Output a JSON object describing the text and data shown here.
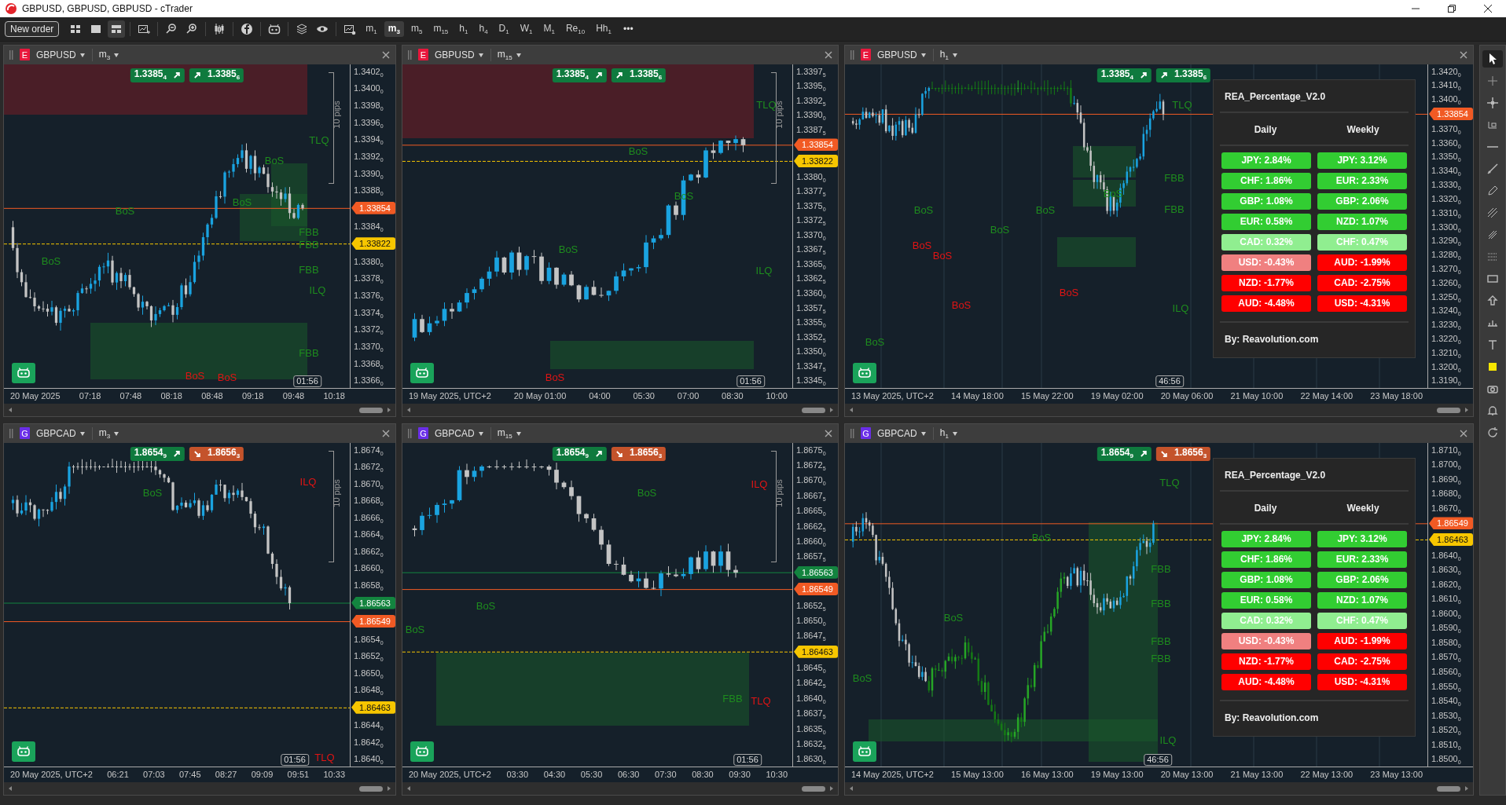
{
  "window": {
    "title": "GBPUSD, GBPUSD, GBPUSD - cTrader"
  },
  "toolbar": {
    "new_order": "New order",
    "more": "•••",
    "timeframes": [
      {
        "label": "m$_{1}$",
        "selected": false
      },
      {
        "label": "m$_{3}$",
        "selected": true
      },
      {
        "label": "m$_{5}$",
        "selected": false
      },
      {
        "label": "m$_{15}$",
        "selected": false
      },
      {
        "label": "h$_{1}$",
        "selected": false
      },
      {
        "label": "h$_{4}$",
        "selected": false
      },
      {
        "label": "D$_{1}$",
        "selected": false
      },
      {
        "label": "W$_{1}$",
        "selected": false
      },
      {
        "label": "M$_{1}$",
        "selected": false
      },
      {
        "label": "Re$_{10}$",
        "selected": false
      },
      {
        "label": "Hh$_{1}$",
        "selected": false
      }
    ]
  },
  "charts": [
    {
      "badge": {
        "letter": "E",
        "color": "#e8173c"
      },
      "symbol": "GBPUSD",
      "timeframe": "m$_{3}$",
      "pips": "10 pips",
      "timer": "01:56",
      "prices": [
        {
          "text": "1.3385$_{4}$",
          "kind": "up"
        },
        {
          "text": "1.3385$_{6}$",
          "kind": "up"
        }
      ],
      "y_axis": [
        {
          "kind": "tick",
          "text": "1.3402$_{0}$"
        },
        {
          "kind": "tick",
          "text": "1.3400$_{0}$"
        },
        {
          "kind": "tick",
          "text": "1.3398$_{0}$"
        },
        {
          "kind": "tick",
          "text": "1.3396$_{0}$"
        },
        {
          "kind": "tick",
          "text": "1.3394$_{0}$"
        },
        {
          "kind": "tick",
          "text": "1.3392$_{0}$"
        },
        {
          "kind": "tick",
          "text": "1.3390$_{0}$"
        },
        {
          "kind": "tick",
          "text": "1.3388$_{0}$"
        },
        {
          "kind": "tag",
          "text": "1.33854",
          "color": "#f15a24"
        },
        {
          "kind": "tick",
          "text": "1.3384$_{0}$"
        },
        {
          "kind": "tag",
          "text": "1.33822",
          "color": "#f7c600"
        },
        {
          "kind": "tick",
          "text": "1.3380$_{0}$"
        },
        {
          "kind": "tick",
          "text": "1.3378$_{0}$"
        },
        {
          "kind": "tick",
          "text": "1.3376$_{0}$"
        },
        {
          "kind": "tick",
          "text": "1.3374$_{0}$"
        },
        {
          "kind": "tick",
          "text": "1.3372$_{0}$"
        },
        {
          "kind": "tick",
          "text": "1.3370$_{0}$"
        },
        {
          "kind": "tick",
          "text": "1.3368$_{0}$"
        },
        {
          "kind": "tick",
          "text": "1.3366$_{0}$"
        }
      ],
      "x_axis": [
        "20 May 2025",
        "07:18",
        "07:48",
        "08:18",
        "08:48",
        "09:18",
        "09:48",
        "10:18"
      ],
      "annotations": [
        {
          "text": "TLQ",
          "color": "#1e8c1e"
        },
        {
          "text": "BoS",
          "color": "#1e8c1e"
        },
        {
          "text": "BoS",
          "color": "#1e8c1e"
        },
        {
          "text": "BoS",
          "color": "#1e8c1e"
        },
        {
          "text": "FBB",
          "color": "#1e8c1e"
        },
        {
          "text": "FBB",
          "color": "#1e8c1e"
        },
        {
          "text": "FBB",
          "color": "#1e8c1e"
        },
        {
          "text": "ILQ",
          "color": "#1e8c1e"
        },
        {
          "text": "BoS",
          "color": "#1e8c1e"
        },
        {
          "text": "FBB",
          "color": "#1e8c1e"
        },
        {
          "text": "BoS",
          "color": "#e01414"
        },
        {
          "text": "BoS",
          "color": "#e01414"
        }
      ]
    },
    {
      "badge": {
        "letter": "E",
        "color": "#e8173c"
      },
      "symbol": "GBPUSD",
      "timeframe": "m$_{15}$",
      "pips": "10 pips",
      "timer": "01:56",
      "prices": [
        {
          "text": "1.3385$_{4}$",
          "kind": "up"
        },
        {
          "text": "1.3385$_{6}$",
          "kind": "up"
        }
      ],
      "y_axis": [
        {
          "kind": "tick",
          "text": "1.3397$_{5}$"
        },
        {
          "kind": "tick",
          "text": "1.3395$_{0}$"
        },
        {
          "kind": "tick",
          "text": "1.3392$_{5}$"
        },
        {
          "kind": "tick",
          "text": "1.3390$_{0}$"
        },
        {
          "kind": "tick",
          "text": "1.3387$_{5}$"
        },
        {
          "kind": "tag",
          "text": "1.33854",
          "color": "#f15a24"
        },
        {
          "kind": "tag",
          "text": "1.33822",
          "color": "#f7c600"
        },
        {
          "kind": "tick",
          "text": "1.3380$_{0}$"
        },
        {
          "kind": "tick",
          "text": "1.3377$_{5}$"
        },
        {
          "kind": "tick",
          "text": "1.3375$_{0}$"
        },
        {
          "kind": "tick",
          "text": "1.3372$_{5}$"
        },
        {
          "kind": "tick",
          "text": "1.3370$_{0}$"
        },
        {
          "kind": "tick",
          "text": "1.3367$_{5}$"
        },
        {
          "kind": "tick",
          "text": "1.3365$_{0}$"
        },
        {
          "kind": "tick",
          "text": "1.3362$_{5}$"
        },
        {
          "kind": "tick",
          "text": "1.3360$_{0}$"
        },
        {
          "kind": "tick",
          "text": "1.3357$_{5}$"
        },
        {
          "kind": "tick",
          "text": "1.3355$_{0}$"
        },
        {
          "kind": "tick",
          "text": "1.3352$_{5}$"
        },
        {
          "kind": "tick",
          "text": "1.3350$_{0}$"
        },
        {
          "kind": "tick",
          "text": "1.3347$_{5}$"
        },
        {
          "kind": "tick",
          "text": "1.3345$_{0}$"
        }
      ],
      "x_axis": [
        "19 May 2025, UTC+2",
        "20 May 01:00",
        "04:00",
        "05:30",
        "07:00",
        "08:30",
        "10:00"
      ],
      "annotations": [
        {
          "text": "TLQ",
          "color": "#1e8c1e"
        },
        {
          "text": "BoS",
          "color": "#1e8c1e"
        },
        {
          "text": "BoS",
          "color": "#1e8c1e"
        },
        {
          "text": "BoS",
          "color": "#1e8c1e"
        },
        {
          "text": "ILQ",
          "color": "#1e8c1e"
        },
        {
          "text": "BoS",
          "color": "#e01414"
        }
      ]
    },
    {
      "badge": {
        "letter": "E",
        "color": "#e8173c"
      },
      "symbol": "GBPUSD",
      "timeframe": "h$_{1}$",
      "timer": "46:56",
      "prices": [
        {
          "text": "1.3385$_{4}$",
          "kind": "up"
        },
        {
          "text": "1.3385$_{6}$",
          "kind": "up"
        }
      ],
      "y_axis": [
        {
          "kind": "tick",
          "text": "1.3420$_{0}$"
        },
        {
          "kind": "tick",
          "text": "1.3410$_{0}$"
        },
        {
          "kind": "tick",
          "text": "1.3400$_{0}$"
        },
        {
          "kind": "tag",
          "text": "1.33854",
          "color": "#f15a24"
        },
        {
          "kind": "tick",
          "text": "1.3370$_{0}$"
        },
        {
          "kind": "tick",
          "text": "1.3360$_{0}$"
        },
        {
          "kind": "tick",
          "text": "1.3350$_{0}$"
        },
        {
          "kind": "tick",
          "text": "1.3340$_{0}$"
        },
        {
          "kind": "tick",
          "text": "1.3330$_{0}$"
        },
        {
          "kind": "tick",
          "text": "1.3320$_{0}$"
        },
        {
          "kind": "tick",
          "text": "1.3310$_{0}$"
        },
        {
          "kind": "tick",
          "text": "1.3300$_{0}$"
        },
        {
          "kind": "tick",
          "text": "1.3290$_{0}$"
        },
        {
          "kind": "tick",
          "text": "1.3280$_{0}$"
        },
        {
          "kind": "tick",
          "text": "1.3270$_{0}$"
        },
        {
          "kind": "tick",
          "text": "1.3260$_{0}$"
        },
        {
          "kind": "tick",
          "text": "1.3250$_{0}$"
        },
        {
          "kind": "tick",
          "text": "1.3240$_{0}$"
        },
        {
          "kind": "tick",
          "text": "1.3230$_{0}$"
        },
        {
          "kind": "tick",
          "text": "1.3220$_{0}$"
        },
        {
          "kind": "tick",
          "text": "1.3210$_{0}$"
        },
        {
          "kind": "tick",
          "text": "1.3200$_{0}$"
        },
        {
          "kind": "tick",
          "text": "1.3190$_{0}$"
        }
      ],
      "x_axis": [
        "13 May 2025, UTC+2",
        "14 May 18:00",
        "15 May 22:00",
        "19 May 02:00",
        "20 May 06:00",
        "21 May 10:00",
        "22 May 14:00",
        "23 May 18:00"
      ],
      "annotations": [
        {
          "text": "TLQ",
          "color": "#1e8c1e"
        },
        {
          "text": "FBB",
          "color": "#1e8c1e"
        },
        {
          "text": "FBB",
          "color": "#1e8c1e"
        },
        {
          "text": "ILQ",
          "color": "#1e8c1e"
        },
        {
          "text": "BoS",
          "color": "#e01414"
        },
        {
          "text": "BoS",
          "color": "#e01414"
        },
        {
          "text": "BoS",
          "color": "#e01414"
        },
        {
          "text": "BoS",
          "color": "#e01414"
        },
        {
          "text": "BoS",
          "color": "#1e8c1e"
        },
        {
          "text": "BoS",
          "color": "#1e8c1e"
        },
        {
          "text": "BoS",
          "color": "#1e8c1e"
        },
        {
          "text": "BoS",
          "color": "#1e8c1e"
        },
        {
          "text": "BoS",
          "color": "#1e8c1e"
        }
      ],
      "indicator_panel": {
        "title": "REA_Percentage_V2.0",
        "columns": [
          "Daily",
          "Weekly"
        ],
        "rows": [
          {
            "cells": [
              {
                "text": "JPY: 2.84%",
                "color": "#32cd32"
              },
              {
                "text": "JPY: 3.12%",
                "color": "#32cd32"
              }
            ]
          },
          {
            "cells": [
              {
                "text": "CHF: 1.86%",
                "color": "#32cd32"
              },
              {
                "text": "EUR: 2.33%",
                "color": "#32cd32"
              }
            ]
          },
          {
            "cells": [
              {
                "text": "GBP: 1.08%",
                "color": "#32cd32"
              },
              {
                "text": "GBP: 2.06%",
                "color": "#32cd32"
              }
            ]
          },
          {
            "cells": [
              {
                "text": "EUR: 0.58%",
                "color": "#32cd32"
              },
              {
                "text": "NZD: 1.07%",
                "color": "#32cd32"
              }
            ]
          },
          {
            "cells": [
              {
                "text": "CAD: 0.32%",
                "color": "#90ee90"
              },
              {
                "text": "CHF: 0.47%",
                "color": "#90ee90"
              }
            ]
          },
          {
            "cells": [
              {
                "text": "USD: -0.43%",
                "color": "#f08080"
              },
              {
                "text": "AUD: -1.99%",
                "color": "#ff0000"
              }
            ]
          },
          {
            "cells": [
              {
                "text": "NZD: -1.77%",
                "color": "#ff0000"
              },
              {
                "text": "CAD: -2.75%",
                "color": "#ff0000"
              }
            ]
          },
          {
            "cells": [
              {
                "text": "AUD: -4.48%",
                "color": "#ff0000"
              },
              {
                "text": "USD: -4.31%",
                "color": "#ff0000"
              }
            ]
          }
        ],
        "footer": "By: Reavolution.com"
      }
    },
    {
      "badge": {
        "letter": "G",
        "color": "#6a2ee8"
      },
      "symbol": "GBPCAD",
      "timeframe": "m$_{3}$",
      "pips": "10 pips",
      "timer": "01:56",
      "prices": [
        {
          "text": "1.8654$_{9}$",
          "kind": "up"
        },
        {
          "text": "1.8656$_{3}$",
          "kind": "down"
        }
      ],
      "y_axis": [
        {
          "kind": "tick",
          "text": "1.8674$_{0}$"
        },
        {
          "kind": "tick",
          "text": "1.8672$_{0}$"
        },
        {
          "kind": "tick",
          "text": "1.8670$_{0}$"
        },
        {
          "kind": "tick",
          "text": "1.8668$_{0}$"
        },
        {
          "kind": "tick",
          "text": "1.8666$_{0}$"
        },
        {
          "kind": "tick",
          "text": "1.8664$_{0}$"
        },
        {
          "kind": "tick",
          "text": "1.8662$_{0}$"
        },
        {
          "kind": "tick",
          "text": "1.8660$_{0}$"
        },
        {
          "kind": "tick",
          "text": "1.8658$_{0}$"
        },
        {
          "kind": "tag",
          "text": "1.86563",
          "color": "#13843f"
        },
        {
          "kind": "tag",
          "text": "1.86549",
          "color": "#f15a24"
        },
        {
          "kind": "tick",
          "text": "1.8654$_{0}$"
        },
        {
          "kind": "tick",
          "text": "1.8652$_{0}$"
        },
        {
          "kind": "tick",
          "text": "1.8650$_{0}$"
        },
        {
          "kind": "tick",
          "text": "1.8648$_{0}$"
        },
        {
          "kind": "tag",
          "text": "1.86463",
          "color": "#f7c600"
        },
        {
          "kind": "tick",
          "text": "1.8644$_{0}$"
        },
        {
          "kind": "tick",
          "text": "1.8642$_{0}$"
        },
        {
          "kind": "tick",
          "text": "1.8640$_{0}$"
        }
      ],
      "x_axis": [
        "20 May 2025, UTC+2",
        "06:21",
        "07:03",
        "07:45",
        "08:27",
        "09:09",
        "09:51",
        "10:33"
      ],
      "annotations": [
        {
          "text": "ILQ",
          "color": "#e01414"
        },
        {
          "text": "BoS",
          "color": "#1e8c1e"
        },
        {
          "text": "TLQ",
          "color": "#e01414"
        }
      ]
    },
    {
      "badge": {
        "letter": "G",
        "color": "#6a2ee8"
      },
      "symbol": "GBPCAD",
      "timeframe": "m$_{15}$",
      "pips": "10 pips",
      "timer": "01:56",
      "prices": [
        {
          "text": "1.8654$_{9}$",
          "kind": "up"
        },
        {
          "text": "1.8656$_{3}$",
          "kind": "down"
        }
      ],
      "y_axis": [
        {
          "kind": "tick",
          "text": "1.8675$_{0}$"
        },
        {
          "kind": "tick",
          "text": "1.8672$_{5}$"
        },
        {
          "kind": "tick",
          "text": "1.8670$_{0}$"
        },
        {
          "kind": "tick",
          "text": "1.8667$_{5}$"
        },
        {
          "kind": "tick",
          "text": "1.8665$_{0}$"
        },
        {
          "kind": "tick",
          "text": "1.8662$_{5}$"
        },
        {
          "kind": "tick",
          "text": "1.8660$_{0}$"
        },
        {
          "kind": "tick",
          "text": "1.8657$_{5}$"
        },
        {
          "kind": "tag",
          "text": "1.86563",
          "color": "#13843f"
        },
        {
          "kind": "tag",
          "text": "1.86549",
          "color": "#f15a24"
        },
        {
          "kind": "tick",
          "text": "1.8652$_{5}$"
        },
        {
          "kind": "tick",
          "text": "1.8650$_{0}$"
        },
        {
          "kind": "tick",
          "text": "1.8647$_{5}$"
        },
        {
          "kind": "tag",
          "text": "1.86463",
          "color": "#f7c600"
        },
        {
          "kind": "tick",
          "text": "1.8645$_{0}$"
        },
        {
          "kind": "tick",
          "text": "1.8642$_{5}$"
        },
        {
          "kind": "tick",
          "text": "1.8640$_{0}$"
        },
        {
          "kind": "tick",
          "text": "1.8637$_{5}$"
        },
        {
          "kind": "tick",
          "text": "1.8635$_{0}$"
        },
        {
          "kind": "tick",
          "text": "1.8632$_{5}$"
        },
        {
          "kind": "tick",
          "text": "1.8630$_{0}$"
        }
      ],
      "x_axis": [
        "20 May 2025, UTC+2",
        "03:30",
        "04:30",
        "05:30",
        "06:30",
        "07:30",
        "08:30",
        "09:30",
        "10:30"
      ],
      "annotations": [
        {
          "text": "ILQ",
          "color": "#e01414"
        },
        {
          "text": "BoS",
          "color": "#1e8c1e"
        },
        {
          "text": "BoS",
          "color": "#1e8c1e"
        },
        {
          "text": "BoS",
          "color": "#1e8c1e"
        },
        {
          "text": "FBB",
          "color": "#1e8c1e"
        },
        {
          "text": "TLQ",
          "color": "#e01414"
        }
      ]
    },
    {
      "badge": {
        "letter": "G",
        "color": "#6a2ee8"
      },
      "symbol": "GBPCAD",
      "timeframe": "h$_{1}$",
      "timer": "46:56",
      "prices": [
        {
          "text": "1.8654$_{9}$",
          "kind": "up"
        },
        {
          "text": "1.8656$_{3}$",
          "kind": "down"
        }
      ],
      "y_axis": [
        {
          "kind": "tick",
          "text": "1.8710$_{0}$"
        },
        {
          "kind": "tick",
          "text": "1.8700$_{0}$"
        },
        {
          "kind": "tick",
          "text": "1.8690$_{0}$"
        },
        {
          "kind": "tick",
          "text": "1.8680$_{0}$"
        },
        {
          "kind": "tick",
          "text": "1.8670$_{0}$"
        },
        {
          "kind": "tag",
          "text": "1.86549",
          "color": "#f15a24"
        },
        {
          "kind": "tag",
          "text": "1.86463",
          "color": "#f7c600"
        },
        {
          "kind": "tick",
          "text": "1.8640$_{0}$"
        },
        {
          "kind": "tick",
          "text": "1.8630$_{0}$"
        },
        {
          "kind": "tick",
          "text": "1.8620$_{0}$"
        },
        {
          "kind": "tick",
          "text": "1.8610$_{0}$"
        },
        {
          "kind": "tick",
          "text": "1.8600$_{0}$"
        },
        {
          "kind": "tick",
          "text": "1.8590$_{0}$"
        },
        {
          "kind": "tick",
          "text": "1.8580$_{0}$"
        },
        {
          "kind": "tick",
          "text": "1.8570$_{0}$"
        },
        {
          "kind": "tick",
          "text": "1.8560$_{0}$"
        },
        {
          "kind": "tick",
          "text": "1.8550$_{0}$"
        },
        {
          "kind": "tick",
          "text": "1.8540$_{0}$"
        },
        {
          "kind": "tick",
          "text": "1.8530$_{0}$"
        },
        {
          "kind": "tick",
          "text": "1.8520$_{0}$"
        },
        {
          "kind": "tick",
          "text": "1.8510$_{0}$"
        },
        {
          "kind": "tick",
          "text": "1.8500$_{0}$"
        }
      ],
      "x_axis": [
        "14 May 2025, UTC+2",
        "15 May 13:00",
        "16 May 13:00",
        "19 May 13:00",
        "20 May 13:00",
        "21 May 13:00",
        "22 May 13:00",
        "23 May 13:00"
      ],
      "annotations": [
        {
          "text": "TLQ",
          "color": "#1e8c1e"
        },
        {
          "text": "FBB",
          "color": "#1e8c1e"
        },
        {
          "text": "FBB",
          "color": "#1e8c1e"
        },
        {
          "text": "FBB",
          "color": "#1e8c1e"
        },
        {
          "text": "FBB",
          "color": "#1e8c1e"
        },
        {
          "text": "ILQ",
          "color": "#1e8c1e"
        },
        {
          "text": "BoS",
          "color": "#1e8c1e"
        },
        {
          "text": "BoS",
          "color": "#1e8c1e"
        },
        {
          "text": "BoS",
          "color": "#1e8c1e"
        }
      ],
      "indicator_panel": {
        "title": "REA_Percentage_V2.0",
        "columns": [
          "Daily",
          "Weekly"
        ],
        "rows": [
          {
            "cells": [
              {
                "text": "JPY: 2.84%",
                "color": "#32cd32"
              },
              {
                "text": "JPY: 3.12%",
                "color": "#32cd32"
              }
            ]
          },
          {
            "cells": [
              {
                "text": "CHF: 1.86%",
                "color": "#32cd32"
              },
              {
                "text": "EUR: 2.33%",
                "color": "#32cd32"
              }
            ]
          },
          {
            "cells": [
              {
                "text": "GBP: 1.08%",
                "color": "#32cd32"
              },
              {
                "text": "GBP: 2.06%",
                "color": "#32cd32"
              }
            ]
          },
          {
            "cells": [
              {
                "text": "EUR: 0.58%",
                "color": "#32cd32"
              },
              {
                "text": "NZD: 1.07%",
                "color": "#32cd32"
              }
            ]
          },
          {
            "cells": [
              {
                "text": "CAD: 0.32%",
                "color": "#90ee90"
              },
              {
                "text": "CHF: 0.47%",
                "color": "#90ee90"
              }
            ]
          },
          {
            "cells": [
              {
                "text": "USD: -0.43%",
                "color": "#f08080"
              },
              {
                "text": "AUD: -1.99%",
                "color": "#ff0000"
              }
            ]
          },
          {
            "cells": [
              {
                "text": "NZD: -1.77%",
                "color": "#ff0000"
              },
              {
                "text": "CAD: -2.75%",
                "color": "#ff0000"
              }
            ]
          },
          {
            "cells": [
              {
                "text": "AUD: -4.48%",
                "color": "#ff0000"
              },
              {
                "text": "USD: -4.31%",
                "color": "#ff0000"
              }
            ]
          }
        ],
        "footer": "By: Reavolution.com"
      }
    }
  ]
}
